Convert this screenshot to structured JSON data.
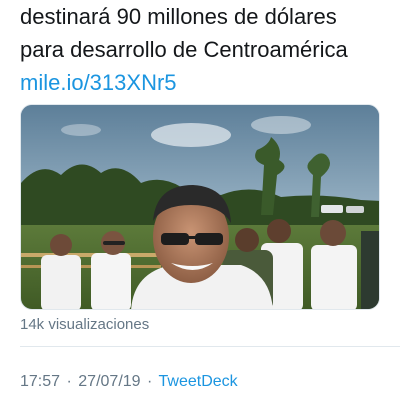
{
  "tweet": {
    "text_line_1": "destinará 90 millones de dólares",
    "text_line_2": "para desarrollo de Centroamérica",
    "link": "mile.io/313XNr5"
  },
  "media": {
    "type": "video",
    "view_count": "14k visualizaciones"
  },
  "meta": {
    "time": "17:57",
    "separator": "·",
    "date": "27/07/19",
    "source": "TweetDeck"
  },
  "colors": {
    "link": "#1b95e0",
    "secondary_text": "#657786",
    "primary_text": "#14171a",
    "divider": "#e1e8ed"
  }
}
